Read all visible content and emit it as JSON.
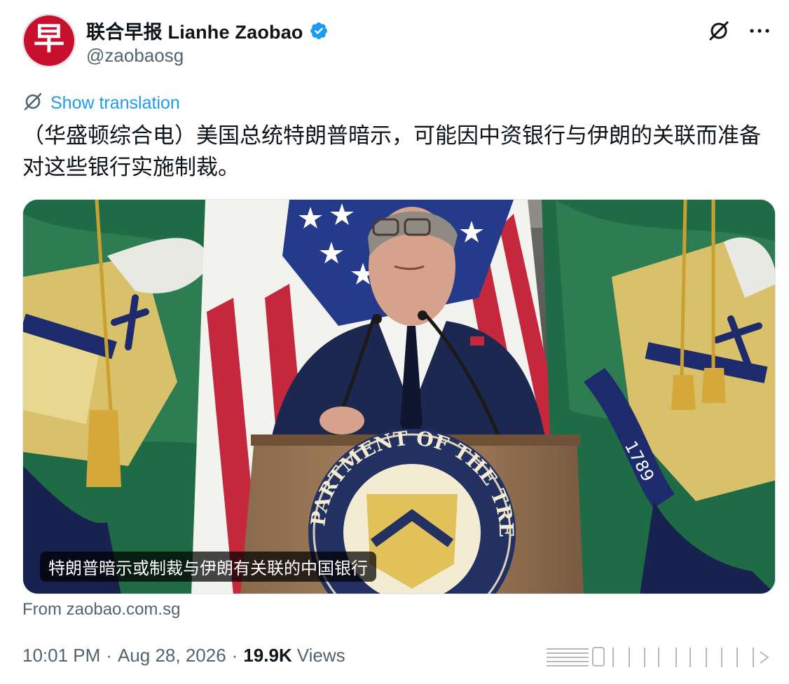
{
  "account": {
    "avatar_glyph": "早",
    "display_name": "联合早报 Lianhe Zaobao",
    "handle": "@zaobaosg",
    "verified": true,
    "avatar_color": "#c8102e",
    "verified_color": "#1d9bf0"
  },
  "header_icons": [
    "grok-icon",
    "more-icon"
  ],
  "translation": {
    "label": "Show translation",
    "icon": "translate-icon"
  },
  "tweet": {
    "text": "（华盛顿综合电）美国总统特朗普暗示，可能因中资银行与伊朗的关联而准备对这些银行实施制裁。"
  },
  "media": {
    "caption": "特朗普暗示或制裁与伊朗有关联的中国银行",
    "seal_text": "THE DEPARTMENT OF THE TREASURY",
    "flag_year": "1789"
  },
  "source": "From zaobao.com.sg",
  "meta": {
    "time": "10:01 PM",
    "date": "Aug 28, 2026",
    "views_count": "19.9K",
    "views_label": "Views"
  },
  "colors": {
    "link": "#1d9bf0",
    "secondary_text": "#536471",
    "primary_text": "#0f1419"
  }
}
